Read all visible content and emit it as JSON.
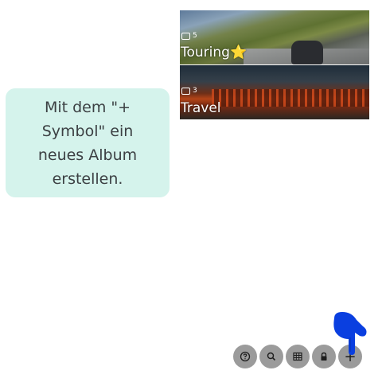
{
  "albums": [
    {
      "count": "5",
      "title": "Touring⭐"
    },
    {
      "count": "3",
      "title": "Travel"
    }
  ],
  "tooltip": {
    "text": "Mit dem \"+ Symbol\" ein neues Album erstellen."
  },
  "toolbar": {
    "buttons": [
      {
        "icon": "help-icon"
      },
      {
        "icon": "search-icon"
      },
      {
        "icon": "grid-icon"
      },
      {
        "icon": "lock-icon"
      },
      {
        "icon": "plus-icon",
        "label": "+"
      }
    ]
  },
  "colors": {
    "tooltip_bg": "#d5f3ec",
    "toolbar_btn": "#9b9b9b",
    "pointer_hand": "#0a3fe0"
  }
}
